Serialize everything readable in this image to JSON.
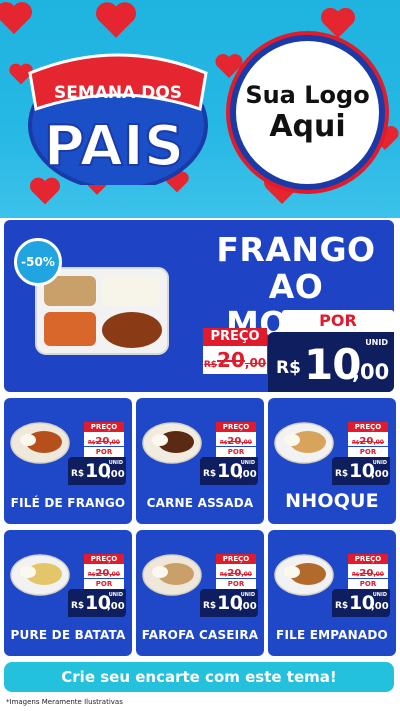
{
  "header": {
    "badge_line1": "SEMANA DOS",
    "badge_line2": "PAIS",
    "logo_line1": "Sua Logo",
    "logo_line2": "Aqui"
  },
  "hero": {
    "discount": "-50%",
    "title_line1": "FRANGO",
    "title_line2": "AO MOLHO",
    "preco_label": "PREÇO",
    "old_currency": "R$",
    "old_price": "20",
    "old_cents": ",00",
    "por_label": "POR",
    "currency": "R$",
    "price": "10",
    "cents": ",00",
    "unit": "UNID"
  },
  "cards": [
    {
      "name": "FILÉ DE FRANGO",
      "preco_label": "PREÇO",
      "old_currency": "R$",
      "old_price": "20",
      "old_cents": ",00",
      "por_label": "POR",
      "currency": "R$",
      "price": "10",
      "cents": ",00",
      "unit": "UNID"
    },
    {
      "name": "CARNE ASSADA",
      "preco_label": "PREÇO",
      "old_currency": "R$",
      "old_price": "20",
      "old_cents": ",00",
      "por_label": "POR",
      "currency": "R$",
      "price": "10",
      "cents": ",00",
      "unit": "UNID"
    },
    {
      "name": "NHOQUE",
      "preco_label": "PREÇO",
      "old_currency": "R$",
      "old_price": "20",
      "old_cents": ",00",
      "por_label": "POR",
      "currency": "R$",
      "price": "10",
      "cents": ",00",
      "unit": "UNID"
    },
    {
      "name": "PURE DE BATATA",
      "preco_label": "PREÇO",
      "old_currency": "R$",
      "old_price": "20",
      "old_cents": ",00",
      "por_label": "POR",
      "currency": "R$",
      "price": "10",
      "cents": ",00",
      "unit": "UNID"
    },
    {
      "name": "FAROFA CASEIRA",
      "preco_label": "PREÇO",
      "old_currency": "R$",
      "old_price": "20",
      "old_cents": ",00",
      "por_label": "POR",
      "currency": "R$",
      "price": "10",
      "cents": ",00",
      "unit": "UNID"
    },
    {
      "name": "FILE EMPANADO",
      "preco_label": "PREÇO",
      "old_currency": "R$",
      "old_price": "20",
      "old_cents": ",00",
      "por_label": "POR",
      "currency": "R$",
      "price": "10",
      "cents": ",00",
      "unit": "UNID"
    }
  ],
  "footer": {
    "cta": "Crie seu encarte com este tema!",
    "note": "*Imagens Meramente Ilustrativas"
  },
  "colors": {
    "sky": "#27b8e4",
    "royal_blue": "#1e43c4",
    "navy": "#0e1e5e",
    "red": "#e01b2c",
    "cyan_button": "#24c1dc"
  },
  "icons": [
    "heart-icon",
    "plate-icon"
  ]
}
